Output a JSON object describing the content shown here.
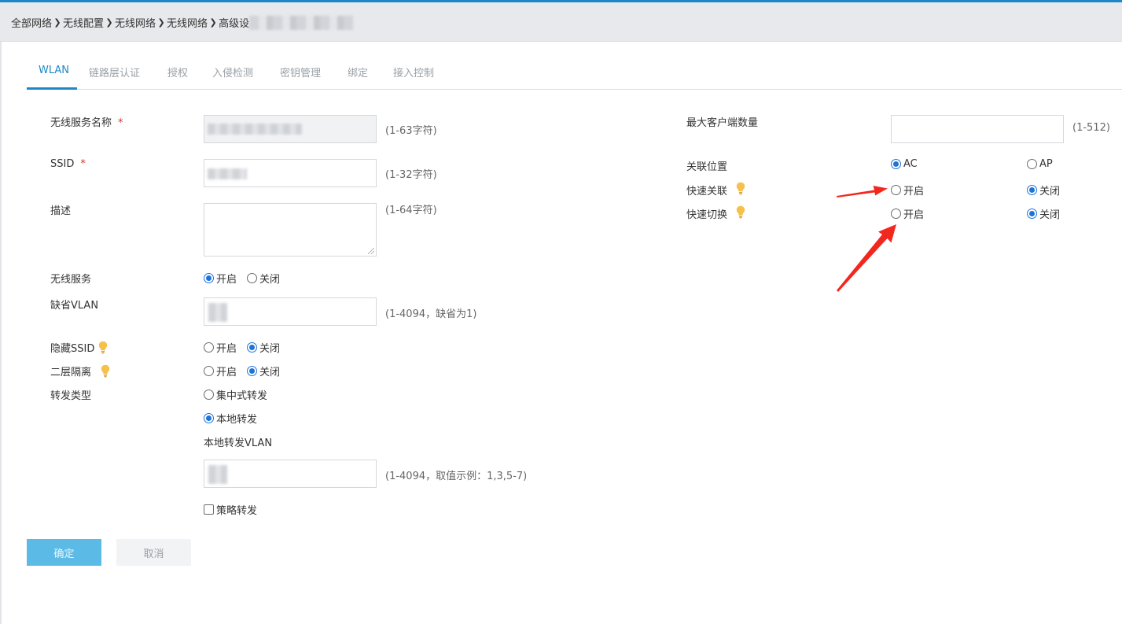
{
  "colors": {
    "accent": "#1e88c7",
    "radio_selected": "#1e73d9",
    "required": "#d9362a",
    "confirm_button": "#5bbbe6",
    "annotation_arrow": "#f2281e",
    "bulb": "#f6c04a"
  },
  "breadcrumb": {
    "items": [
      "全部网络",
      "无线配置",
      "无线网络",
      "无线网络",
      "高级设"
    ],
    "separator_icon": "chevron-right-icon"
  },
  "tabs": [
    {
      "label": "WLAN",
      "active": true
    },
    {
      "label": "链路层认证",
      "active": false
    },
    {
      "label": "授权",
      "active": false
    },
    {
      "label": "入侵检测",
      "active": false
    },
    {
      "label": "密钥管理",
      "active": false
    },
    {
      "label": "绑定",
      "active": false
    },
    {
      "label": "接入控制",
      "active": false
    }
  ],
  "form_left": {
    "service_name": {
      "label": "无线服务名称",
      "required_mark": "*",
      "hint": "(1-63字符)"
    },
    "ssid": {
      "label": "SSID",
      "required_mark": "*",
      "hint": "(1-32字符)"
    },
    "description": {
      "label": "描述",
      "hint": "(1-64字符)"
    },
    "wireless_service": {
      "label": "无线服务",
      "options": [
        "开启",
        "关闭"
      ],
      "selected": "开启"
    },
    "default_vlan": {
      "label": "缺省VLAN",
      "hint": "(1-4094，缺省为1)"
    },
    "hide_ssid": {
      "label": "隐藏SSID",
      "options": [
        "开启",
        "关闭"
      ],
      "selected": "关闭",
      "icon": "lightbulb-icon"
    },
    "l2_isolation": {
      "label": "二层隔离",
      "options": [
        "开启",
        "关闭"
      ],
      "selected": "关闭",
      "icon": "lightbulb-icon"
    },
    "forwarding_type": {
      "label": "转发类型",
      "options": [
        "集中式转发",
        "本地转发"
      ],
      "selected": "本地转发",
      "local_vlan_label": "本地转发VLAN",
      "local_vlan_hint": "(1-4094，取值示例：1,3,5-7)",
      "policy_forwarding": {
        "label": "策略转发",
        "checked": false
      }
    }
  },
  "form_right": {
    "max_clients": {
      "label": "最大客户端数量",
      "hint": "(1-512)"
    },
    "association_location": {
      "label": "关联位置",
      "options": [
        "AC",
        "AP"
      ],
      "selected": "AC"
    },
    "fast_association": {
      "label": "快速关联",
      "options": [
        "开启",
        "关闭"
      ],
      "selected": "关闭",
      "icon": "lightbulb-icon"
    },
    "fast_roaming": {
      "label": "快速切换",
      "options": [
        "开启",
        "关闭"
      ],
      "selected": "关闭",
      "icon": "lightbulb-icon"
    }
  },
  "buttons": {
    "confirm": "确定",
    "cancel": "取消"
  }
}
